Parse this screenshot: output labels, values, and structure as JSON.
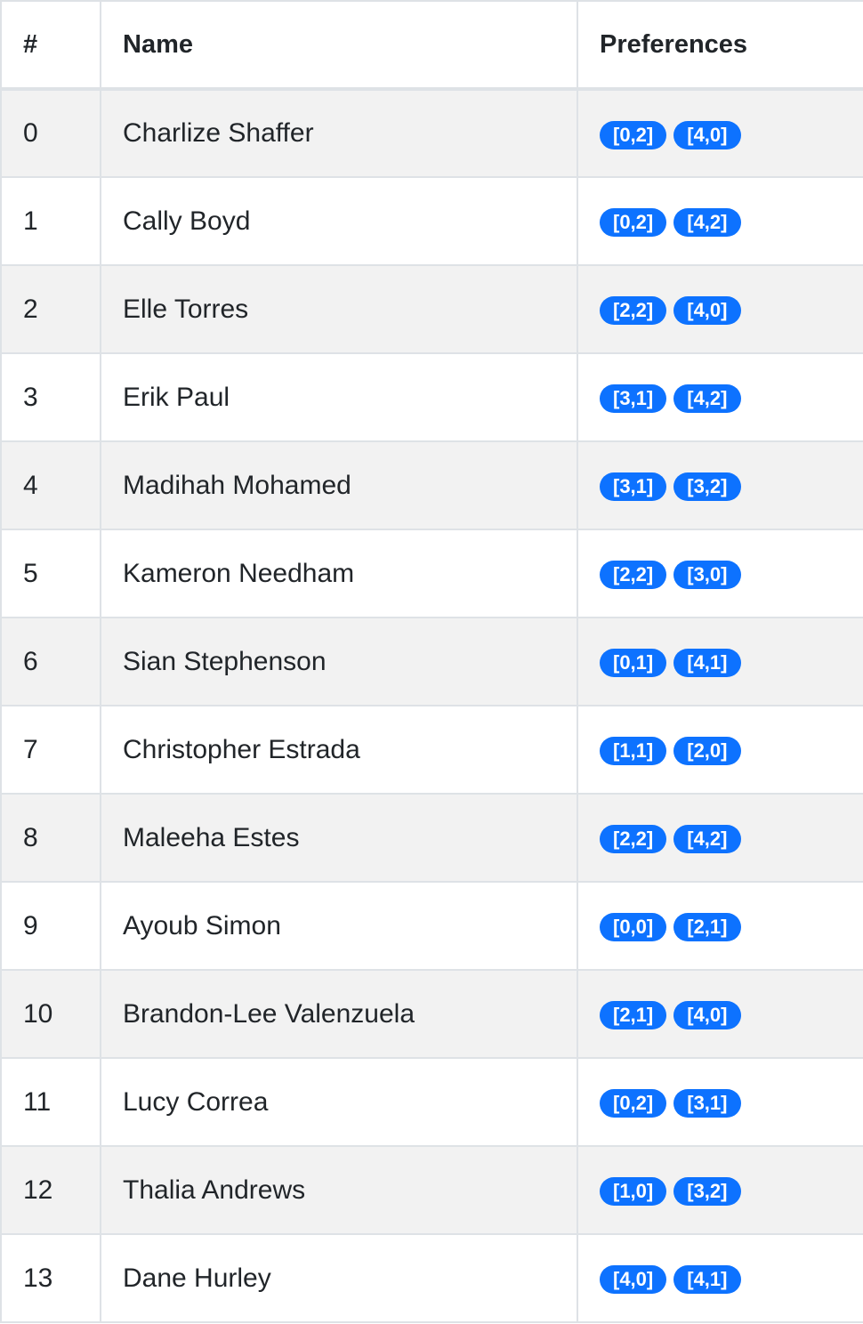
{
  "table": {
    "headers": [
      "#",
      "Name",
      "Preferences"
    ],
    "rows": [
      {
        "idx": "0",
        "name": "Charlize Shaffer",
        "prefs": [
          "[0,2]",
          "[4,0]"
        ]
      },
      {
        "idx": "1",
        "name": "Cally Boyd",
        "prefs": [
          "[0,2]",
          "[4,2]"
        ]
      },
      {
        "idx": "2",
        "name": "Elle Torres",
        "prefs": [
          "[2,2]",
          "[4,0]"
        ]
      },
      {
        "idx": "3",
        "name": "Erik Paul",
        "prefs": [
          "[3,1]",
          "[4,2]"
        ]
      },
      {
        "idx": "4",
        "name": "Madihah Mohamed",
        "prefs": [
          "[3,1]",
          "[3,2]"
        ]
      },
      {
        "idx": "5",
        "name": "Kameron Needham",
        "prefs": [
          "[2,2]",
          "[3,0]"
        ]
      },
      {
        "idx": "6",
        "name": "Sian Stephenson",
        "prefs": [
          "[0,1]",
          "[4,1]"
        ]
      },
      {
        "idx": "7",
        "name": "Christopher Estrada",
        "prefs": [
          "[1,1]",
          "[2,0]"
        ]
      },
      {
        "idx": "8",
        "name": "Maleeha Estes",
        "prefs": [
          "[2,2]",
          "[4,2]"
        ]
      },
      {
        "idx": "9",
        "name": "Ayoub Simon",
        "prefs": [
          "[0,0]",
          "[2,1]"
        ]
      },
      {
        "idx": "10",
        "name": "Brandon-Lee Valenzuela",
        "prefs": [
          "[2,1]",
          "[4,0]"
        ]
      },
      {
        "idx": "11",
        "name": "Lucy Correa",
        "prefs": [
          "[0,2]",
          "[3,1]"
        ]
      },
      {
        "idx": "12",
        "name": "Thalia Andrews",
        "prefs": [
          "[1,0]",
          "[3,2]"
        ]
      },
      {
        "idx": "13",
        "name": "Dane Hurley",
        "prefs": [
          "[4,0]",
          "[4,1]"
        ]
      }
    ]
  },
  "colors": {
    "badge": "#0d72ff",
    "stripe": "#f2f2f2",
    "border": "#dee2e6"
  }
}
